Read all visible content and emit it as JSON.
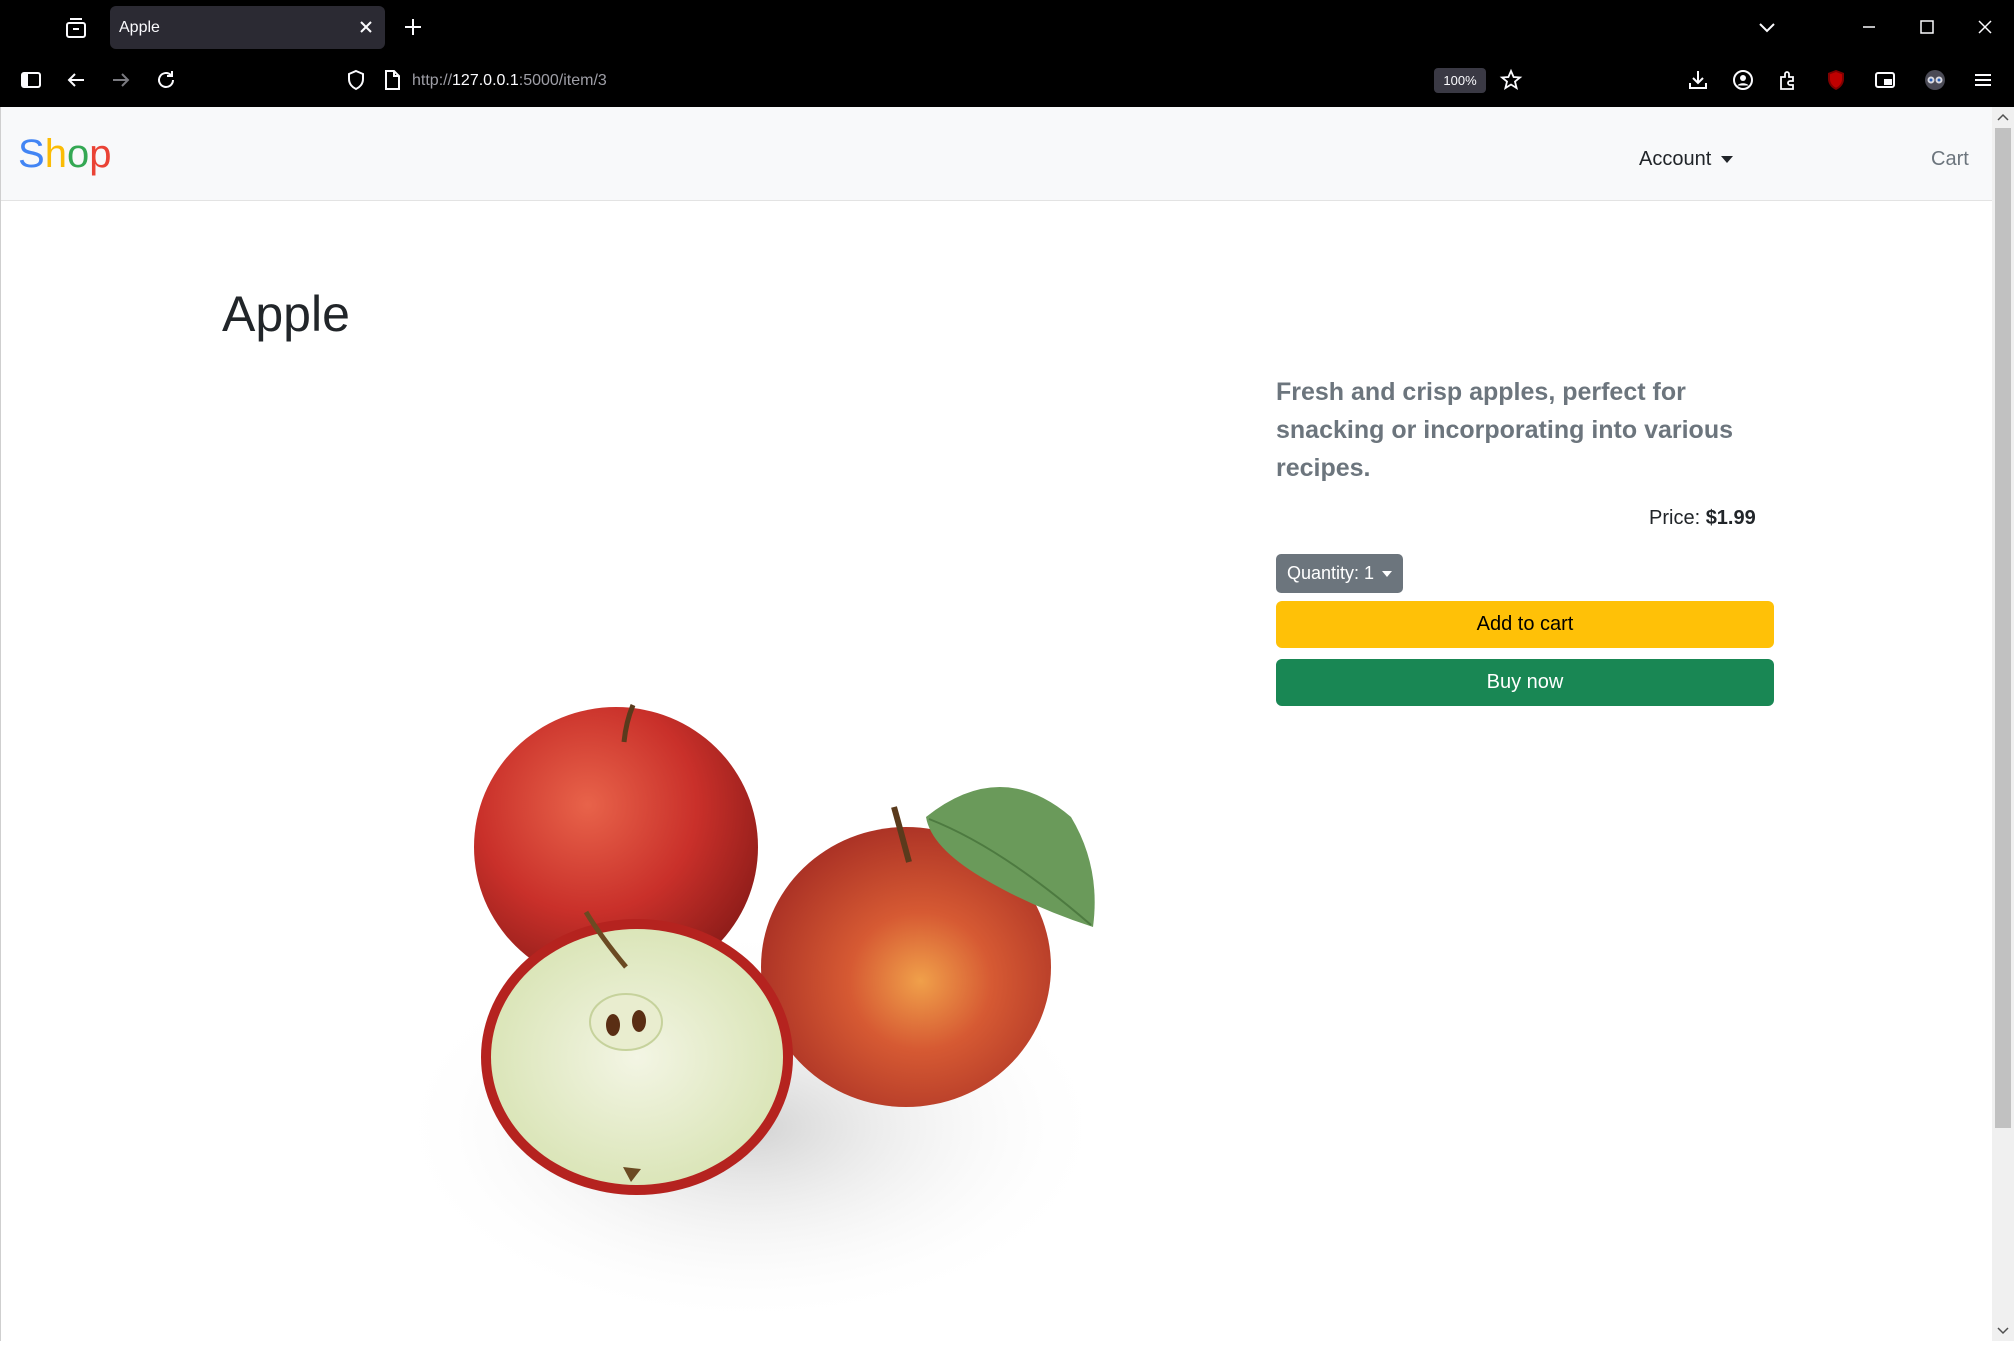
{
  "browser": {
    "tab_title": "Apple",
    "url_prefix": "http://",
    "url_host": "127.0.0.1",
    "url_rest": ":5000/item/3",
    "zoom": "100%"
  },
  "site": {
    "brand": [
      "S",
      "h",
      "o",
      "p"
    ],
    "brand_colors": [
      "#4285F4",
      "#FBBC05",
      "#34A853",
      "#EA4335"
    ],
    "nav_account": "Account",
    "nav_cart": "Cart"
  },
  "product": {
    "title": "Apple",
    "description": "Fresh and crisp apples, perfect for snacking or incorporating into various recipes.",
    "price_label": "Price:",
    "price_value": "$1.99",
    "quantity_label": "Quantity: 1",
    "add_to_cart": "Add to cart",
    "buy_now": "Buy now"
  },
  "colors": {
    "add_to_cart": "#ffc107",
    "buy_now": "#198754",
    "quantity": "#6c757d"
  }
}
